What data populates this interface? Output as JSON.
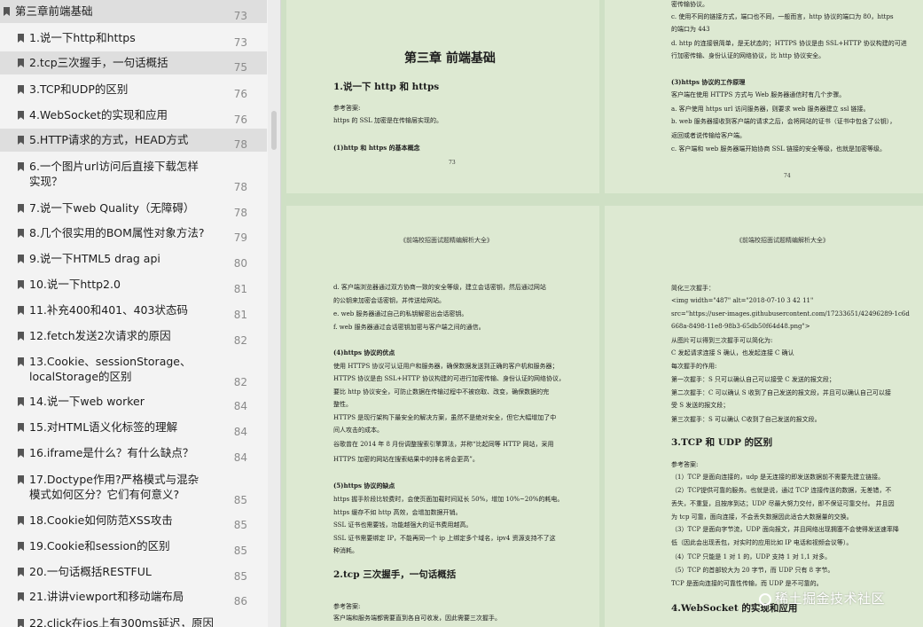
{
  "sidebar": {
    "items": [
      {
        "title": "第三章前端基础",
        "page": "73",
        "level": 0,
        "selected": true,
        "lines": 1
      },
      {
        "title": "1.说一下http和https",
        "page": "73",
        "level": 1,
        "selected": false,
        "lines": 1
      },
      {
        "title": "2.tcp三次握手，一句话概括",
        "page": "75",
        "level": 1,
        "selected": true,
        "lines": 1
      },
      {
        "title": "3.TCP和UDP的区别",
        "page": "76",
        "level": 1,
        "selected": false,
        "lines": 1
      },
      {
        "title": "4.WebSocket的实现和应用",
        "page": "76",
        "level": 1,
        "selected": false,
        "lines": 1
      },
      {
        "title": "5.HTTP请求的方式，HEAD方式",
        "page": "78",
        "level": 1,
        "selected": true,
        "lines": 1
      },
      {
        "title": "6.一个图片url访问后直接下载怎样实现？",
        "page": "78",
        "level": 1,
        "selected": false,
        "lines": 2
      },
      {
        "title": "7.说一下web Quality（无障碍）",
        "page": "78",
        "level": 1,
        "selected": false,
        "lines": 1
      },
      {
        "title": "8.几个很实用的BOM属性对象方法?",
        "page": "79",
        "level": 1,
        "selected": false,
        "lines": 1
      },
      {
        "title": "9.说一下HTML5 drag api",
        "page": "80",
        "level": 1,
        "selected": false,
        "lines": 1
      },
      {
        "title": "10.说一下http2.0",
        "page": "81",
        "level": 1,
        "selected": false,
        "lines": 1
      },
      {
        "title": "11.补充400和401、403状态码",
        "page": "81",
        "level": 1,
        "selected": false,
        "lines": 1
      },
      {
        "title": "12.fetch发送2次请求的原因",
        "page": "82",
        "level": 1,
        "selected": false,
        "lines": 1
      },
      {
        "title": "13.Cookie、sessionStorage、localStorage的区别",
        "page": "82",
        "level": 1,
        "selected": false,
        "lines": 2
      },
      {
        "title": "14.说一下web worker",
        "page": "84",
        "level": 1,
        "selected": false,
        "lines": 1
      },
      {
        "title": "15.对HTML语义化标签的理解",
        "page": "84",
        "level": 1,
        "selected": false,
        "lines": 1
      },
      {
        "title": "16.iframe是什么？有什么缺点？",
        "page": "84",
        "level": 1,
        "selected": false,
        "lines": 1
      },
      {
        "title": "17.Doctype作用?严格模式与混杂模式如何区分？它们有何意义?",
        "page": "85",
        "level": 1,
        "selected": false,
        "lines": 2
      },
      {
        "title": "18.Cookie如何防范XSS攻击",
        "page": "85",
        "level": 1,
        "selected": false,
        "lines": 1
      },
      {
        "title": "19.Cookie和session的区别",
        "page": "85",
        "level": 1,
        "selected": false,
        "lines": 1
      },
      {
        "title": "20.一句话概括RESTFUL",
        "page": "85",
        "level": 1,
        "selected": false,
        "lines": 1
      },
      {
        "title": "21.讲讲viewport和移动端布局",
        "page": "86",
        "level": 1,
        "selected": false,
        "lines": 1
      },
      {
        "title": "22.click在ios上有300ms延迟，原因",
        "page": "",
        "level": 1,
        "selected": false,
        "lines": 1
      }
    ]
  },
  "pages": {
    "p73": {
      "chapter_title": "第三章 前端基础",
      "heading": "1.说一下 http 和 https",
      "answer_label": "参考答案:",
      "line1": "https 的 SSL 加密是在传输层实现的。",
      "subheading": "(1)http 和 https 的基本概念",
      "page_number": "73"
    },
    "p74": {
      "line_a": "密传输协议。",
      "line_b": "c. 使用不同的链接方式，端口也不同，一般而言，http 协议的端口为 80，https",
      "line_c": "的端口为 443",
      "line_d": "d. http 的连接很简单，是无状态的；HTTPS 协议是由 SSL+HTTP 协议构建的可进",
      "line_e": "行加密传输、身份认证的网络协议，比 http 协议安全。",
      "subheading": "(3)https 协议的工作原理",
      "line_f": "客户端在使用 HTTPS 方式与 Web 服务器通信时有几个步骤。",
      "line_g": "a. 客户使用 https url 访问服务器，则要求 web 服务器建立 ssl 链接。",
      "line_h": "b. web 服务器接收到客户端的请求之后，会将网站的证书（证书中包含了公钥），",
      "line_i": "返回或者说传输给客户端。",
      "line_j": "c. 客户端和 web 服务器端开始协商 SSL 链接的安全等级，也就是加密等级。",
      "page_number": "74"
    },
    "p75": {
      "header": "《前端校招面试题精编解析大全》",
      "l1": "d. 客户端浏览器通过双方协商一致的安全等级，建立会话密钥，然后通过网站",
      "l2": "的公钥来加密会话密钥，并传送给网站。",
      "l3": "e. web 服务器通过自己的私钥解密出会话密钥。",
      "l4": "f. web 服务器通过会话密钥加密与客户端之间的通信。",
      "sh1": "(4)https 协议的优点",
      "l5": "使用 HTTPS 协议可认证用户和服务器，确保数据发送到正确的客户机和服务器；",
      "l6": "HTTPS 协议是由 SSL+HTTP 协议构建的可进行加密传输、身份认证的网络协议，",
      "l7": "要比 http 协议安全，可防止数据在传输过程中不被窃取、改变，确保数据的完",
      "l8": "整性。",
      "l9": "HTTPS 是现行架构下最安全的解决方案，虽然不是绝对安全，但它大幅增加了中",
      "l10": "间人攻击的成本。",
      "l11": "谷歌曾在 2014 年 8 月份调整搜索引擎算法，并称“比起同等 HTTP 网站，采用",
      "l12": "HTTPS 加密的网站在搜索结果中的排名将会更高”。",
      "sh2": "(5)https 协议的缺点",
      "l13": "https 握手阶段比较费时，会使页面加载时间延长 50%，增加 10%~20%的耗电。",
      "l14": "https 缓存不如 http 高效，会增加数据开销。",
      "l15": "SSL 证书也需要钱，功能越强大的证书费用越高。",
      "l16": "SSL 证书需要绑定 IP，不能再同一个 ip 上绑定多个域名，ipv4 资源支持不了这",
      "l17": "种消耗。",
      "heading": "2.tcp 三次握手，一句话概括",
      "answer_label": "参考答案:",
      "l18": "客户端和服务端都需要直到各自可收发，因此需要三次握手。"
    },
    "p76": {
      "header": "《前端校招面试题精编解析大全》",
      "l1": "简化三次握手：",
      "l2": "<img width=\"487\" alt=\"2018-07-10 3 42 11\"",
      "l3": "src=\"https://user-images.githubusercontent.com/17233651/42496289-1c6d",
      "l4": "668a-8498-11e8-98b3-65db50f64d48.png\">",
      "l5": "从图片可以得到三次握手可以简化为:",
      "l6": "C 发起请求连接 S 确认，也发起连接 C 确认",
      "l7": "每次握手的作用:",
      "l8": "第一次握手：S 只可以确认自己可以接受 C 发送的报文段；",
      "l9": "第二次握手：C 可以确认 S 收到了自己发送的报文段，并且可以确认自己可以接",
      "l10": "受 S 发送的报文段；",
      "l11": "第三次握手：S 可以确认 C收到了自己发送的报文段。",
      "heading": "3.TCP 和 UDP 的区别",
      "answer_label": "参考答案:",
      "l12": "（1）TCP 是面向连接的，udp 是无连接的即发送数据前不需要先建立链接。",
      "l13": "（2）TCP提供可靠的服务。也就是说，通过 TCP 连接传送的数据，无差错，不",
      "l14": "丢失，不重复，且按序到达；UDP 尽最大努力交付，即不保证可靠交付。 并且因",
      "l15": "为 tcp 可靠，面向连接，不会丢失数据因此适合大数据量的交换。",
      "l16": "（3）TCP 是面向字节流，UDP 面向报文，并且网络出现拥塞不会使得发送速率降",
      "l17": "低（因此会出现丢包，对实时的应用比如 IP 电话和视频会议等）。",
      "l18": "（4）TCP 只能是 1 对 1 的，UDP 支持 1 对 1,1 对多。",
      "l19": "（5）TCP 的首部较大为 20 字节，而 UDP 只有 8 字节。",
      "l20": "TCP 是面向连接的可靠性传输，而 UDP 是不可靠的。",
      "heading2": "4.WebSocket 的实现和应用"
    }
  },
  "watermark": "稀土掘金技术社区",
  "colors": {
    "viewer_bg": "#cfe0c5",
    "page_bg": "#dde9d2",
    "sidebar_bg": "#f3f3f3",
    "selected_bg": "#dedede"
  }
}
